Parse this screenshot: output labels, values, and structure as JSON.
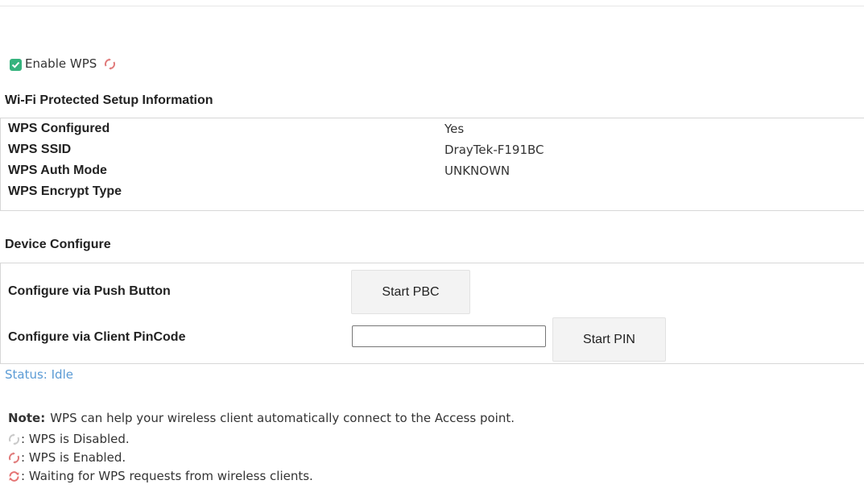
{
  "enable_wps": {
    "label": "Enable WPS",
    "checked": true
  },
  "info": {
    "heading": "Wi-Fi Protected Setup Information",
    "rows": [
      {
        "key": "WPS Configured",
        "value": "Yes"
      },
      {
        "key": "WPS SSID",
        "value": "DrayTek-F191BC"
      },
      {
        "key": "WPS Auth Mode",
        "value": "UNKNOWN"
      },
      {
        "key": "WPS Encrypt Type",
        "value": ""
      }
    ]
  },
  "device": {
    "heading": "Device Configure",
    "push_label": "Configure via Push Button",
    "pbc_button": "Start PBC",
    "pin_label": "Configure via Client PinCode",
    "pin_value": "",
    "pin_button": "Start PIN"
  },
  "status": "Status: Idle",
  "note": {
    "prefix": "Note:",
    "text": "WPS can help your wireless client automatically connect to the Access point.",
    "legend": [
      {
        "icon": "wps-disabled-icon",
        "text": ": WPS is Disabled."
      },
      {
        "icon": "wps-enabled-icon",
        "text": ": WPS is Enabled."
      },
      {
        "icon": "wps-waiting-icon",
        "text": ": Waiting for WPS requests from wireless clients."
      }
    ]
  },
  "colors": {
    "checkbox": "#36b37e",
    "status": "#5b9bd5",
    "wps_disabled": "#c8c8c8",
    "wps_enabled": "#e07a7a",
    "wps_waiting": "#e57373"
  }
}
